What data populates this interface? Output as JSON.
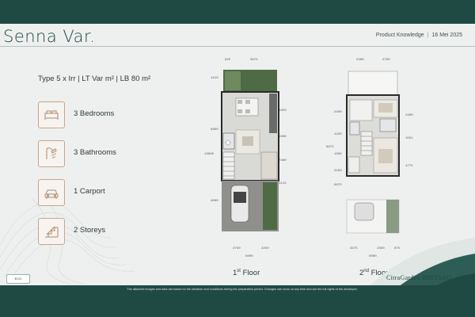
{
  "header": {
    "title": "Senna Var.",
    "product_knowledge": "Product Knowledge",
    "date": "16 Mei 2025"
  },
  "spec": {
    "type_line": "Type 5 x Irr  |  LT Var m²  |  LB 80 m²"
  },
  "features": [
    {
      "icon": "bed-icon",
      "label": "3 Bedrooms"
    },
    {
      "icon": "shower-icon",
      "label": "3 Bathrooms"
    },
    {
      "icon": "car-icon",
      "label": "1 Carport"
    },
    {
      "icon": "stairs-icon",
      "label": "2 Storeys"
    }
  ],
  "floors": {
    "first": {
      "label_num": "1",
      "label_sup": "st",
      "label_word": "Floor",
      "dims": {
        "top_a": "925",
        "top_b": "3875",
        "left_a": "1410",
        "left_b": "6800",
        "left_c": "13000",
        "left_d": "4000",
        "right_a": "3450",
        "right_b": "1906",
        "right_c": "2480",
        "right_d": "1115",
        "bottom_a": "2750",
        "bottom_b": "2250",
        "bottom_total": "5000"
      }
    },
    "second": {
      "label_num": "2",
      "label_sup": "nd",
      "label_word": "Floor",
      "dims": {
        "top_a": "2300",
        "top_b": "2700",
        "left_a": "2400",
        "left_b": "1420",
        "left_c": "1300",
        "left_d": "3100",
        "left_e": "6875",
        "left_total": "8875",
        "right_a": "2400",
        "right_b": "1501",
        "right_c": "4775",
        "bottom_a": "3375",
        "bottom_b": "2350",
        "bottom_c": "675",
        "bottom_total": "5000"
      }
    }
  },
  "footer": {
    "disclaimer": "The attached images and data are based on the situation and conditions during the preparation period. Changes can occur at any time and are the full rights of the developer.",
    "brand": "CitraGarden BINTARO",
    "eco_badge": "ECO"
  },
  "colors": {
    "primary": "#1f4a44",
    "accent": "#c9a58a",
    "background": "#eef0ef"
  }
}
